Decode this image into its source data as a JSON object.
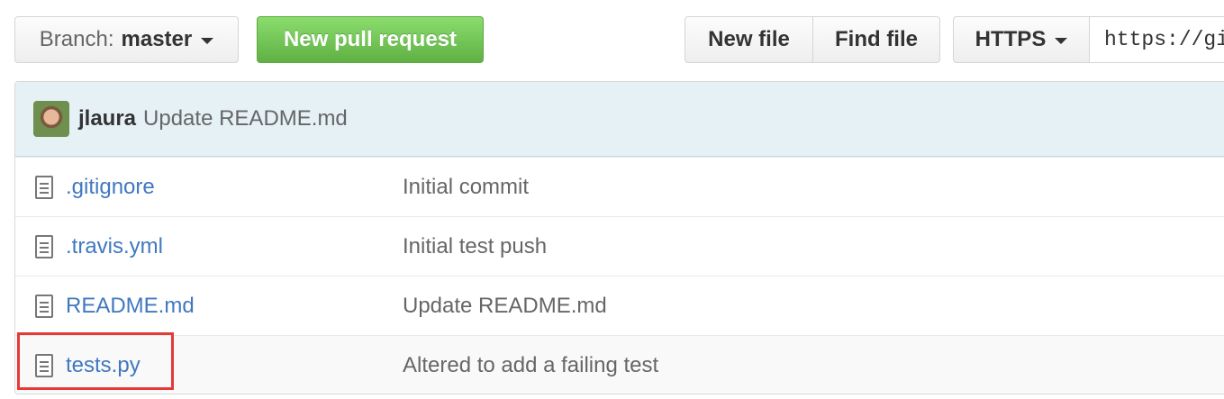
{
  "toolbar": {
    "branch_prefix": "Branch:",
    "branch_name": "master",
    "new_pull_request": "New pull request",
    "new_file": "New file",
    "find_file": "Find file",
    "protocol": "HTTPS",
    "clone_url": "https://gi"
  },
  "latest_commit": {
    "author": "jlaura",
    "message": "Update README.md"
  },
  "files": [
    {
      "name": ".gitignore",
      "commit": "Initial commit"
    },
    {
      "name": ".travis.yml",
      "commit": "Initial test push"
    },
    {
      "name": "README.md",
      "commit": "Update README.md"
    },
    {
      "name": "tests.py",
      "commit": "Altered to add a failing test"
    }
  ],
  "colors": {
    "link": "#4078c0",
    "primary_button": "#60b044",
    "commit_bar": "#e6f1f6",
    "highlight": "#e53935"
  }
}
